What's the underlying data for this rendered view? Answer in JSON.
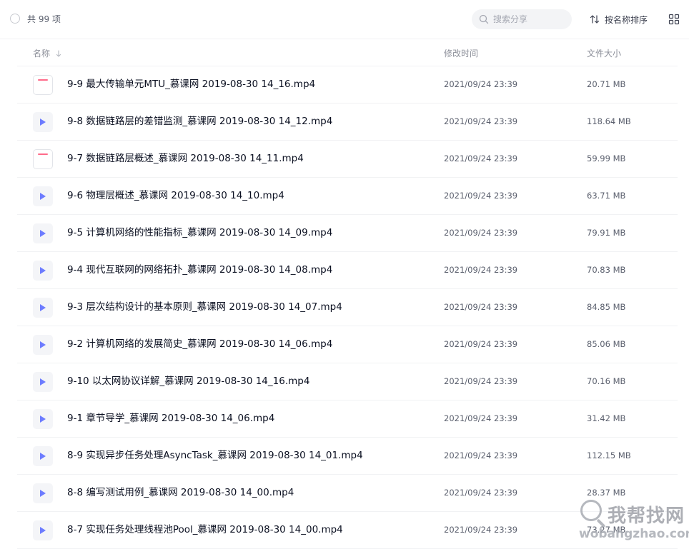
{
  "toolbar": {
    "count_label": "共 99 项",
    "search_placeholder": "搜索分享",
    "sort_label": "按名称排序"
  },
  "columns": {
    "name": "名称",
    "modified": "修改时间",
    "size": "文件大小"
  },
  "files": [
    {
      "name": "9-9 最大传输单元MTU_慕课网 2019-08-30 14_16.mp4",
      "modified": "2021/09/24 23:39",
      "size": "20.71 MB",
      "icon": "doc"
    },
    {
      "name": "9-8 数据链路层的差错监测_慕课网 2019-08-30 14_12.mp4",
      "modified": "2021/09/24 23:39",
      "size": "118.64 MB",
      "icon": "video"
    },
    {
      "name": "9-7 数据链路层概述_慕课网 2019-08-30 14_11.mp4",
      "modified": "2021/09/24 23:39",
      "size": "59.99 MB",
      "icon": "doc"
    },
    {
      "name": "9-6 物理层概述_慕课网 2019-08-30 14_10.mp4",
      "modified": "2021/09/24 23:39",
      "size": "63.71 MB",
      "icon": "video"
    },
    {
      "name": "9-5 计算机网络的性能指标_慕课网 2019-08-30 14_09.mp4",
      "modified": "2021/09/24 23:39",
      "size": "79.91 MB",
      "icon": "video"
    },
    {
      "name": "9-4 现代互联网的网络拓扑_慕课网 2019-08-30 14_08.mp4",
      "modified": "2021/09/24 23:39",
      "size": "70.83 MB",
      "icon": "video"
    },
    {
      "name": "9-3 层次结构设计的基本原则_慕课网 2019-08-30 14_07.mp4",
      "modified": "2021/09/24 23:39",
      "size": "84.85 MB",
      "icon": "video"
    },
    {
      "name": "9-2 计算机网络的发展简史_慕课网 2019-08-30 14_06.mp4",
      "modified": "2021/09/24 23:39",
      "size": "85.06 MB",
      "icon": "video"
    },
    {
      "name": "9-10 以太网协议详解_慕课网 2019-08-30 14_16.mp4",
      "modified": "2021/09/24 23:39",
      "size": "70.16 MB",
      "icon": "video"
    },
    {
      "name": "9-1 章节导学_慕课网 2019-08-30 14_06.mp4",
      "modified": "2021/09/24 23:39",
      "size": "31.42 MB",
      "icon": "video"
    },
    {
      "name": "8-9 实现异步任务处理AsyncTask_慕课网 2019-08-30 14_01.mp4",
      "modified": "2021/09/24 23:39",
      "size": "112.15 MB",
      "icon": "video"
    },
    {
      "name": "8-8 编写测试用例_慕课网 2019-08-30 14_00.mp4",
      "modified": "2021/09/24 23:39",
      "size": "28.37 MB",
      "icon": "video"
    },
    {
      "name": "8-7 实现任务处理线程池Pool_慕课网 2019-08-30 14_00.mp4",
      "modified": "2021/09/24 23:39",
      "size": "73.27 MB",
      "icon": "video"
    }
  ],
  "watermark": {
    "text": "我帮找网",
    "domain": "wobangzhao.com"
  }
}
